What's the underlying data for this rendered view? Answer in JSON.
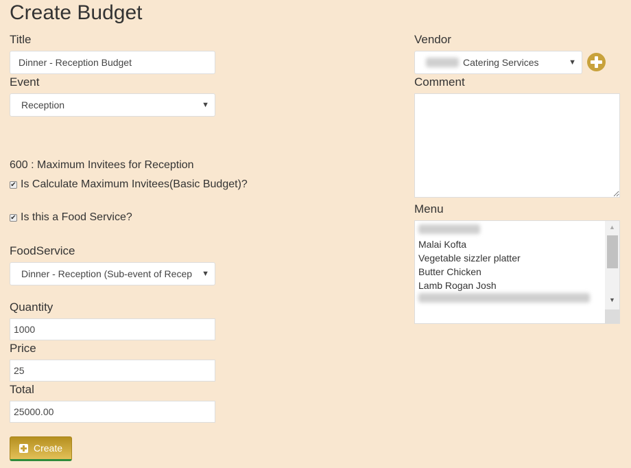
{
  "page": {
    "title": "Create Budget"
  },
  "form": {
    "title": {
      "label": "Title",
      "value": "Dinner - Reception Budget"
    },
    "event": {
      "label": "Event",
      "selected": "Reception"
    },
    "max_invitees_text": "600 : Maximum Invitees for Reception",
    "calc_max_invitees": {
      "label": "Is Calculate Maximum Invitees(Basic Budget)?",
      "checked": true
    },
    "is_food_service": {
      "label": "Is this a Food Service?",
      "checked": true
    },
    "food_service": {
      "label": "FoodService",
      "selected": "Dinner - Reception (Sub-event of Recep"
    },
    "quantity": {
      "label": "Quantity",
      "value": "1000"
    },
    "price": {
      "label": "Price",
      "value": "25"
    },
    "total": {
      "label": "Total",
      "value": "25000.00"
    },
    "create_button": {
      "label": "Create"
    },
    "vendor": {
      "label": "Vendor",
      "selected_visible": "Catering Services",
      "prefix_redacted": true
    },
    "comment": {
      "label": "Comment",
      "value": ""
    },
    "menu": {
      "label": "Menu",
      "items": [
        {
          "text": "",
          "redacted": true
        },
        {
          "text": "Malai Kofta"
        },
        {
          "text": "Vegetable sizzler platter"
        },
        {
          "text": "Butter Chicken"
        },
        {
          "text": "Lamb Rogan Josh"
        },
        {
          "text": "",
          "redacted": true
        }
      ]
    }
  },
  "icons": {
    "select_caret": "▼",
    "checkbox_check": "✔",
    "scroll_up": "▲",
    "scroll_down": "▼",
    "resize_grip": "◢"
  },
  "colors": {
    "background": "#f9e7d0",
    "accent_gold": "#c8a23c",
    "button_border_bottom": "#2e8b3a"
  }
}
